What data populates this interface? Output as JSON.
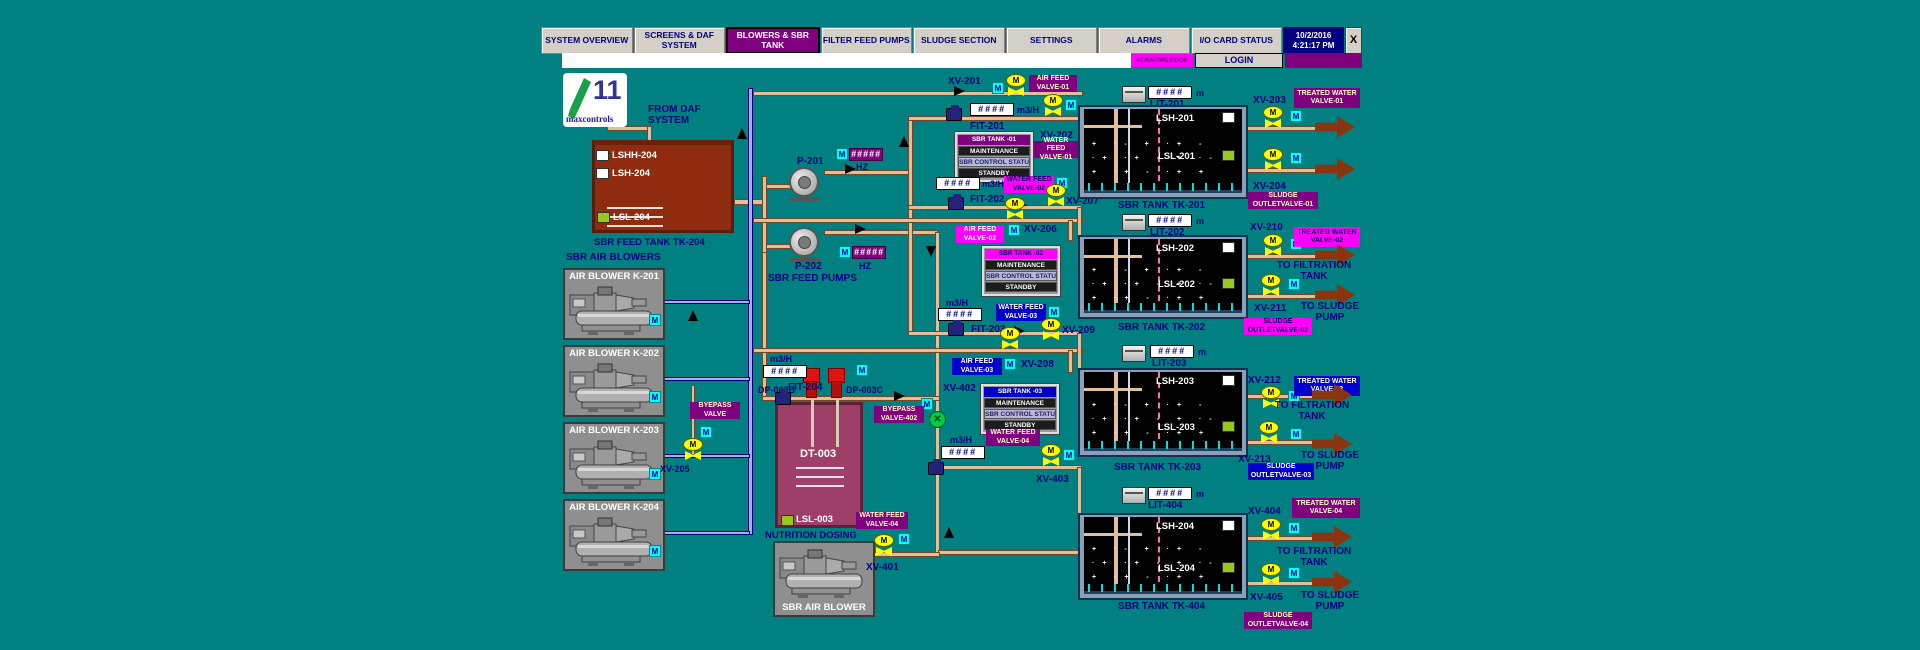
{
  "colors": {
    "background": "#008080",
    "active_tab": "#800080",
    "purple_label": "#800080",
    "magenta_label": "#ff00ff",
    "blue_label": "#0000cc",
    "display_text": "#000080",
    "valve_yellow": "#ffff00",
    "motor_cyan": "#00ffff",
    "pipe_tan": "#e2bf98",
    "alarm_green": "#95c818",
    "brown_arrow": "#8a3410",
    "datetime_bg": "#000080"
  },
  "header": {
    "tabs": [
      {
        "label": "SYSTEM OVERVIEW"
      },
      {
        "label": "SCREENS & DAF SYSTEM"
      },
      {
        "label": "BLOWERS & SBR TANK",
        "active": true
      },
      {
        "label": "FILTER FEED PUMPS"
      },
      {
        "label": "SLUDGE SECTION"
      },
      {
        "label": "SETTINGS"
      },
      {
        "label": "ALARMS"
      },
      {
        "label": "I/O CARD STATUS"
      }
    ],
    "date": "10/2/2016",
    "time": "4:21:17 PM",
    "close": "X",
    "acknowledge": "ACKNOWLEDGE",
    "login": "LOGIN"
  },
  "logo": {
    "number": "11",
    "name": "maxcontrols"
  },
  "m": "M",
  "units": {
    "m3h": "m3/H",
    "m": "m",
    "hz": "HZ"
  },
  "display_hash4": "####",
  "display_hash5": "#####",
  "daf": {
    "line1": "FROM DAF",
    "line2": "SYSTEM"
  },
  "feed_tank": {
    "lshh": "LSHH-204",
    "lsh": "LSH-204",
    "lsl": "LSL-204",
    "label": "SBR FEED TANK TK-204"
  },
  "feed_pumps": {
    "title": "SBR FEED PUMPS",
    "p1": "P-201",
    "p2": "P-202"
  },
  "air_blowers": {
    "title": "SBR AIR BLOWERS",
    "items": [
      {
        "label": "AIR BLOWER K-201"
      },
      {
        "label": "AIR BLOWER K-202"
      },
      {
        "label": "AIR BLOWER K-203"
      },
      {
        "label": "AIR BLOWER K-204"
      }
    ],
    "bypass_label": "BYEPASS VALVE",
    "bypass_tag": "XV-205",
    "single_label": "SBR AIR BLOWER"
  },
  "dosing": {
    "pump_b": "DP-003B",
    "pump_c": "DP-003C",
    "tank": "DT-003",
    "lsl": "LSL-003",
    "title": "NUTRITION DOSING"
  },
  "sections": [
    {
      "xv_air": "XV-201",
      "air_label": "AIR FEED VALVE-01",
      "fit": "FIT-201",
      "xv_water": "XV-202",
      "water_label": "WATER FEED VALVE-01",
      "panel": {
        "title": "SBR TANK -01",
        "row1": "MAINTENANCE",
        "row2": "SBR CONTROL STATUS",
        "row3": "STANDBY"
      }
    },
    {
      "xv_air": "XV-206",
      "air_label": "AIR FEED VALVE-02",
      "fit": "FIT-202",
      "xv_water": "XV-207",
      "water_label": "WATER FEED VALVE-02",
      "panel": {
        "title": "SBR TANK -02",
        "row1": "MAINTENANCE",
        "row2": "SBR CONTROL STATUS",
        "row3": "STANDBY"
      }
    },
    {
      "xv_air": "XV-208",
      "air_label": "AIR FEED VALVE-03",
      "fit": "FIT-203",
      "xv_water": "XV-209",
      "water_label": "WATER FEED VALVE-03",
      "panel": {
        "title": "SBR TANK -03",
        "row1": "MAINTENANCE",
        "row2": "SBR CONTROL STATUS",
        "row3": "STANDBY"
      }
    }
  ],
  "line4": {
    "fit": "FIT-204",
    "xv_bypass": "XV-402",
    "bypass_label": "BYEPASS VALVE-402",
    "xv_feed": "XV-403",
    "feed_label": "WATER FEED VALVE-04",
    "xv_blower": "XV-401",
    "blower_valve_label": "WATER FEED VALVE-04"
  },
  "tanks": [
    {
      "lit": "LIT-201",
      "lsh": "LSH-201",
      "lsl": "LSL-201",
      "label": "SBR TANK TK-201",
      "xv_out": "XV-203",
      "out_label": "TREATED WATER VALVE-01",
      "xv_sludge": "XV-204",
      "sludge_label": "SLUDGE OUTLETVALVE-01"
    },
    {
      "lit": "LIT-202",
      "lsh": "LSH-202",
      "lsl": "LSL-202",
      "label": "SBR TANK TK-202",
      "xv_out": "XV-210",
      "out_label": "TREATED WATER VALVE-02",
      "to_filtration": "TO FILTRATION TANK",
      "xv_sludge": "XV-211",
      "to_sludge": "TO SLUDGE PUMP",
      "sludge_label": "SLUDGE OUTLETVALVE-02"
    },
    {
      "lit": "LIT-203",
      "lsh": "LSH-203",
      "lsl": "LSL-203",
      "label": "SBR TANK TK-203",
      "xv_out": "XV-212",
      "out_label": "TREATED WATER VALVE-03",
      "to_filtration": "TO FILTRATION TANK",
      "xv_sludge": "XV-213",
      "to_sludge": "TO SLUDGE PUMP",
      "sludge_label": "SLUDGE OUTLETVALVE-03"
    },
    {
      "lit": "LIT-404",
      "lsh": "LSH-204",
      "lsl": "LSL-204",
      "label": "SBR TANK TK-404",
      "xv_out": "XV-404",
      "out_label": "TREATED WATER VALVE-04",
      "to_filtration": "TO FILTRATION TANK",
      "xv_sludge": "XV-405",
      "to_sludge": "TO SLUDGE PUMP",
      "sludge_label": "SLUDGE OUTLETVALVE-04"
    }
  ]
}
